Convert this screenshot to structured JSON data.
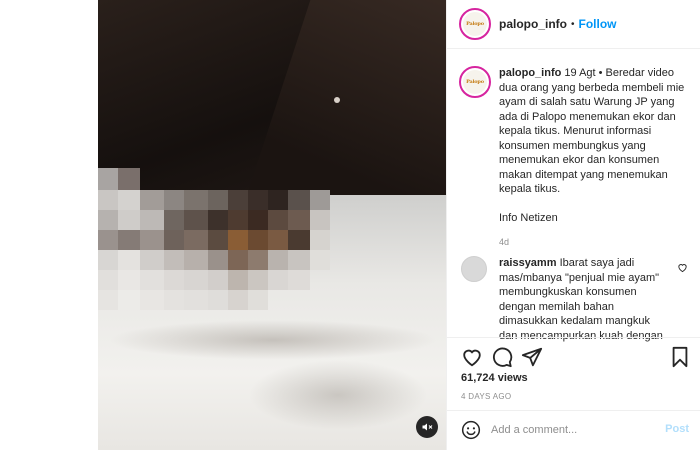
{
  "header": {
    "username": "palopo_info",
    "separator": "•",
    "follow_label": "Follow",
    "avatar_text": "Palopo"
  },
  "caption": {
    "username": "palopo_info",
    "text": "19 Agt • Beredar video dua orang yang berbeda membeli mie ayam di salah satu Warung JP yang ada di Palopo menemukan ekor dan kepala tikus. Menurut informasi konsumen membungkus yang menemukan ekor dan konsumen makan ditempat yang menemukan kepala tikus.",
    "source": "Info Netizen",
    "age": "4d"
  },
  "comment": {
    "username": "raissyamm",
    "text": "Ibarat saya jadi mas/mbanya \"penjual mie ayam\" membungkuskan konsumen dengan memilah bahan dimasukkan kedalam mangkuk dan mencampurkan kuah dengan"
  },
  "stats": {
    "views": "61,724 views",
    "time_ago": "4 DAYS AGO"
  },
  "add_comment": {
    "placeholder": "Add a comment...",
    "post_label": "Post"
  },
  "icons": {
    "like": "heart-icon",
    "comment": "comment-icon",
    "share": "paper-plane-icon",
    "save": "bookmark-icon",
    "mute": "speaker-muted-icon",
    "emoji": "smiley-icon"
  },
  "colors": {
    "link": "#0095f6",
    "post_disabled": "#b2dffc",
    "muted_text": "#8e8e8e"
  }
}
